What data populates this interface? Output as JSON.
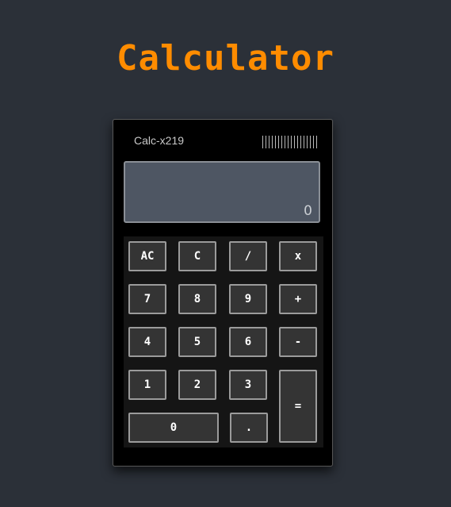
{
  "page": {
    "title": "Calculator"
  },
  "calculator": {
    "model": "Calc-x219",
    "display_value": "0",
    "keys": {
      "ac": "AC",
      "c": "C",
      "divide": "/",
      "multiply": "x",
      "seven": "7",
      "eight": "8",
      "nine": "9",
      "plus": "+",
      "four": "4",
      "five": "5",
      "six": "6",
      "minus": "-",
      "one": "1",
      "two": "2",
      "three": "3",
      "equals": "=",
      "zero": "0",
      "decimal": "."
    }
  },
  "colors": {
    "background": "#2b3038",
    "title": "#ff8c00",
    "display": "#4e5663",
    "key": "#343434",
    "key_border": "#9b9b9b"
  }
}
